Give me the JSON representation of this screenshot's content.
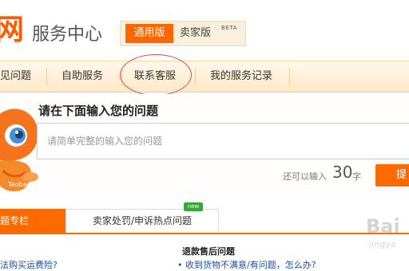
{
  "header": {
    "logo_text": "网",
    "title": "服务中心",
    "version_active": "通用版",
    "version_other": "卖家版",
    "version_badge": "BETA"
  },
  "nav": {
    "items": [
      {
        "label": "见问题"
      },
      {
        "label": "自助服务"
      },
      {
        "label": "联系客服"
      },
      {
        "label": "我的服务记录"
      }
    ]
  },
  "search": {
    "prompt": "请在下面输入您的问题",
    "placeholder": "请简单完整的输入您的问题",
    "counter_label": "还可以输入",
    "counter_value": "30",
    "counter_unit": "字",
    "submit_label": "提"
  },
  "mascot": {
    "label": "Taobao"
  },
  "tabs": [
    {
      "label": "题专栏"
    },
    {
      "label": "卖家处罚/申诉热点问题"
    }
  ],
  "new_badge": "new",
  "faq": {
    "left_item": "法购买运费险?",
    "right_heading": "退款售后问题",
    "right_item": "• 收到货物不满意/有问题，怎么办?"
  },
  "watermark": {
    "main": "Bai",
    "sub": "jingya"
  },
  "colors": {
    "accent": "#ff6a00",
    "nav_bg": "#ffe9c6",
    "link": "#1a4d9c",
    "highlight_circle": "#e24b4b"
  }
}
